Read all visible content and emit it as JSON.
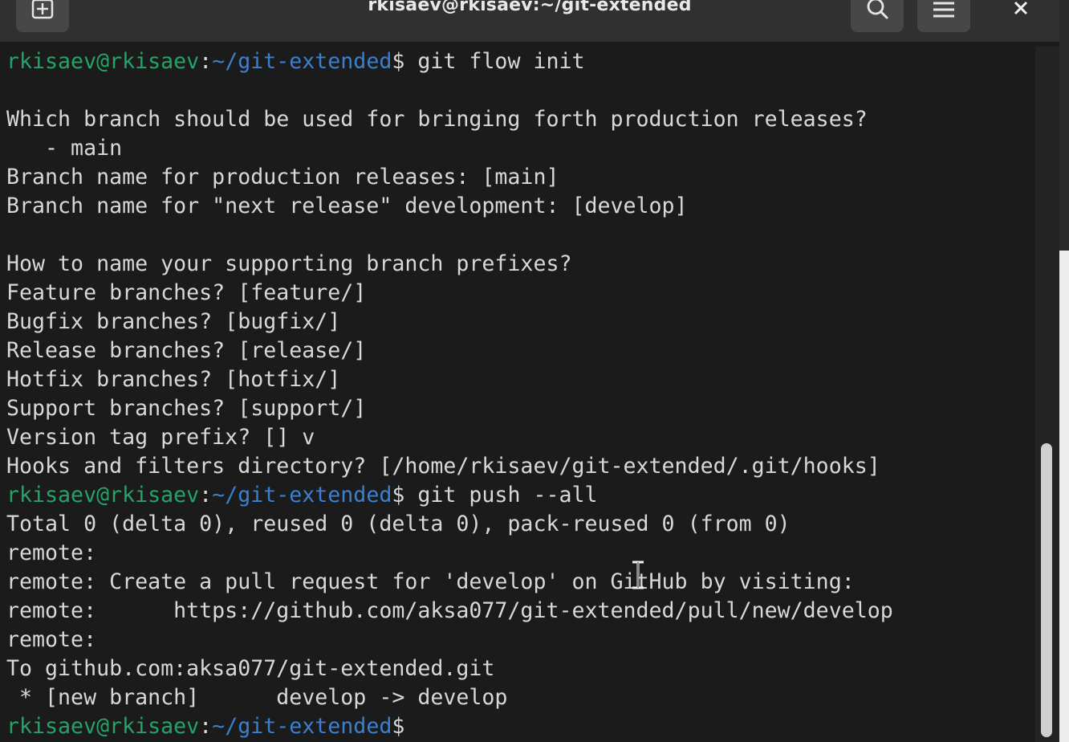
{
  "window": {
    "title": "rkisaev@rkisaev:~/git-extended"
  },
  "toolbar": {
    "new_tab_icon": "new-tab-icon",
    "search_icon": "search-icon",
    "menu_icon": "hamburger-menu-icon",
    "close_icon": "close-icon"
  },
  "colors": {
    "prompt_user": "#26a269",
    "prompt_path": "#3a7fd0",
    "text": "#d8d8d8",
    "background": "#1b1b1b"
  },
  "terminal": {
    "prompt_user": "rkisaev@rkisaev",
    "prompt_sep": ":",
    "prompt_path": "~/git-extended",
    "prompt_end": "$",
    "lines": [
      {
        "type": "prompt",
        "cmd": " git flow init"
      },
      {
        "type": "text",
        "text": ""
      },
      {
        "type": "text",
        "text": "Which branch should be used for bringing forth production releases?"
      },
      {
        "type": "text",
        "text": "   - main"
      },
      {
        "type": "text",
        "text": "Branch name for production releases: [main]"
      },
      {
        "type": "text",
        "text": "Branch name for \"next release\" development: [develop]"
      },
      {
        "type": "text",
        "text": ""
      },
      {
        "type": "text",
        "text": "How to name your supporting branch prefixes?"
      },
      {
        "type": "text",
        "text": "Feature branches? [feature/]"
      },
      {
        "type": "text",
        "text": "Bugfix branches? [bugfix/]"
      },
      {
        "type": "text",
        "text": "Release branches? [release/]"
      },
      {
        "type": "text",
        "text": "Hotfix branches? [hotfix/]"
      },
      {
        "type": "text",
        "text": "Support branches? [support/]"
      },
      {
        "type": "text",
        "text": "Version tag prefix? [] v"
      },
      {
        "type": "text",
        "text": "Hooks and filters directory? [/home/rkisaev/git-extended/.git/hooks]"
      },
      {
        "type": "prompt",
        "cmd": " git push --all"
      },
      {
        "type": "text",
        "text": "Total 0 (delta 0), reused 0 (delta 0), pack-reused 0 (from 0)"
      },
      {
        "type": "text",
        "text": "remote:"
      },
      {
        "type": "text",
        "text": "remote: Create a pull request for 'develop' on GitHub by visiting:"
      },
      {
        "type": "text",
        "text": "remote:      https://github.com/aksa077/git-extended/pull/new/develop"
      },
      {
        "type": "text",
        "text": "remote:"
      },
      {
        "type": "text",
        "text": "To github.com:aksa077/git-extended.git"
      },
      {
        "type": "text",
        "text": " * [new branch]      develop -> develop"
      },
      {
        "type": "prompt",
        "cmd": ""
      }
    ]
  }
}
